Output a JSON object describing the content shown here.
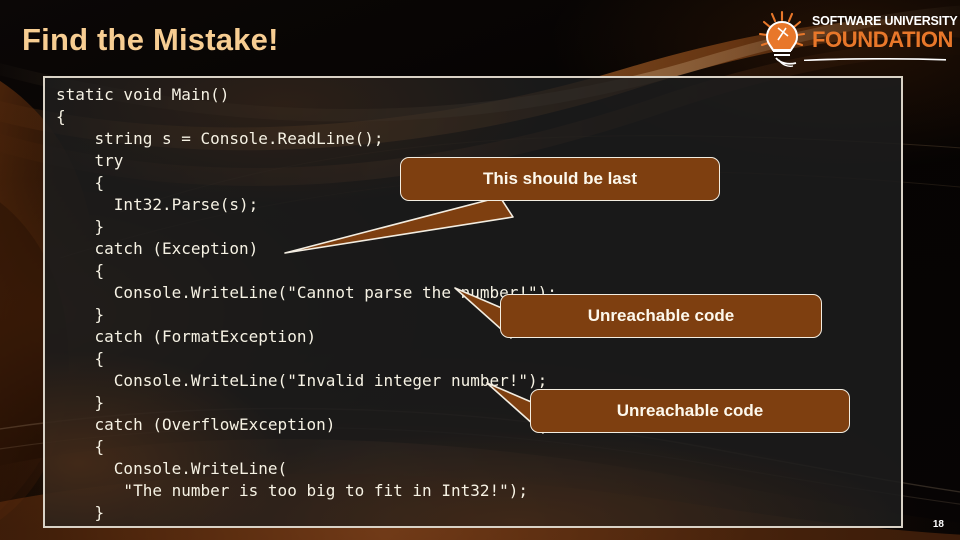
{
  "slide": {
    "title": "Find the Mistake!",
    "page_number": "18",
    "accent_color": "#7e3f10",
    "title_color": "#f7cd92",
    "code_text_color": "#f6f2e4"
  },
  "logo": {
    "icon": "lightbulb-icon",
    "line1": "SOFTWARE UNIVERSITY",
    "line2": "FOUNDATION",
    "line1_color": "#ffffff",
    "line2_color": "#e8772a"
  },
  "code": {
    "language": "csharp",
    "content": "static void Main()\n{\n    string s = Console.ReadLine();\n    try\n    {\n      Int32.Parse(s);\n    }\n    catch (Exception)\n    {\n      Console.WriteLine(\"Cannot parse the number!\");\n    }\n    catch (FormatException)\n    {\n      Console.WriteLine(\"Invalid integer number!\");\n    }\n    catch (OverflowException)\n    {\n      Console.WriteLine(\n       \"The number is too big to fit in Int32!\");\n    }\n}",
    "lines": [
      "static void Main()",
      "{",
      "    string s = Console.ReadLine();",
      "    try",
      "    {",
      "      Int32.Parse(s);",
      "    }",
      "    catch (Exception)",
      "    {",
      "      Console.WriteLine(\"Cannot parse the number!\");",
      "    }",
      "    catch (FormatException)",
      "    {",
      "      Console.WriteLine(\"Invalid integer number!\");",
      "    }",
      "    catch (OverflowException)",
      "    {",
      "      Console.WriteLine(",
      "       \"The number is too big to fit in Int32!\");",
      "    }",
      "}"
    ]
  },
  "callouts": [
    {
      "id": "callout-1",
      "label": "This should be last",
      "points_to": "catch (Exception)"
    },
    {
      "id": "callout-2",
      "label": "Unreachable code",
      "points_to": "catch (FormatException)"
    },
    {
      "id": "callout-3",
      "label": "Unreachable code",
      "points_to": "catch (OverflowException)"
    }
  ]
}
